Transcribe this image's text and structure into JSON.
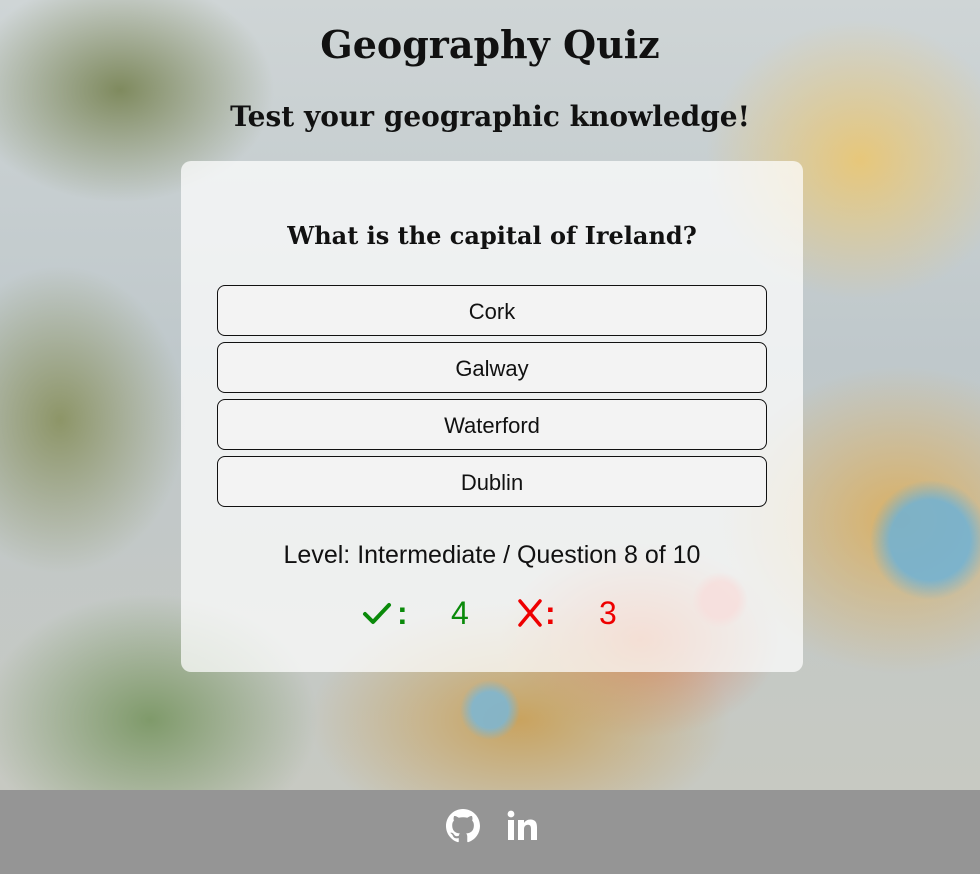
{
  "header": {
    "title": "Geography Quiz",
    "subtitle": "Test your geographic knowledge!"
  },
  "quiz": {
    "question": "What is the capital of Ireland?",
    "answers": [
      "Cork",
      "Galway",
      "Waterford",
      "Dublin"
    ],
    "level_text": "Level: Intermediate / Question 8 of 10",
    "score": {
      "correct_icon": "check-icon",
      "correct_separator": ":",
      "correct_count": "4",
      "incorrect_icon": "x-icon",
      "incorrect_separator": ":",
      "incorrect_count": "3"
    }
  },
  "footer": {
    "links": [
      "github-icon",
      "linkedin-icon"
    ]
  },
  "colors": {
    "correct": "#0a8a0a",
    "incorrect": "#e00000",
    "footer_bg": "#959595"
  }
}
